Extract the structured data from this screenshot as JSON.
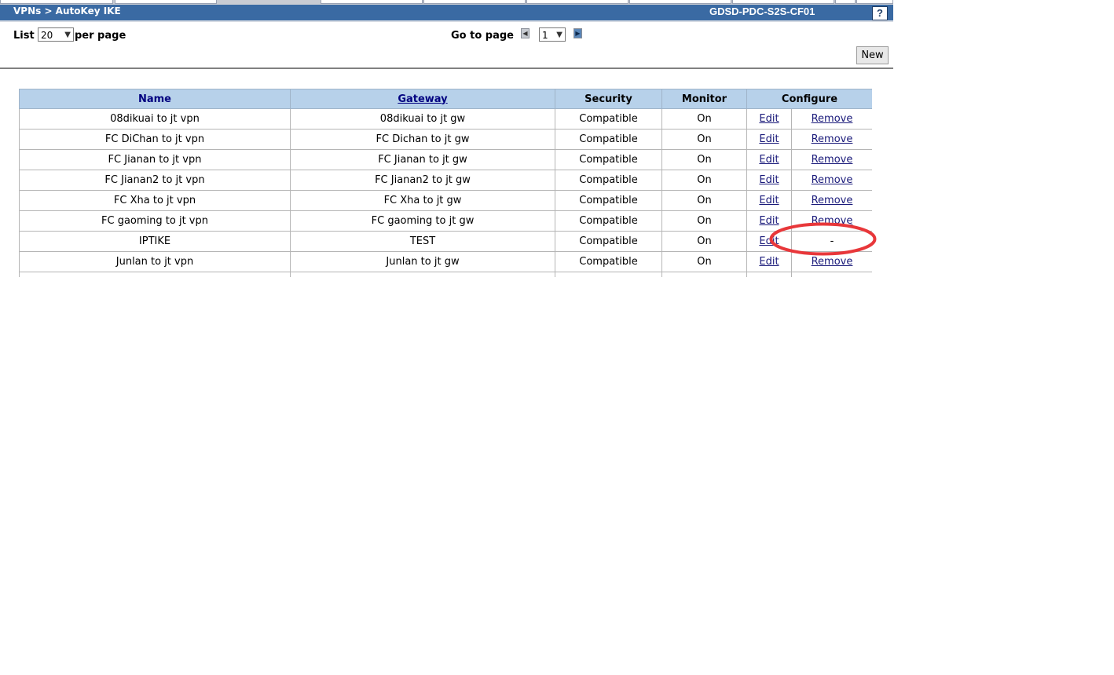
{
  "header": {
    "breadcrumb": "VPNs > AutoKey IKE",
    "device_name": "GDSD-PDC-S2S-CF01",
    "help_label": "?"
  },
  "controls": {
    "list_label": "List",
    "per_page_value": "20",
    "per_page_label": "per page",
    "goto_label": "Go to page",
    "page_value": "1",
    "new_label": "New"
  },
  "table": {
    "columns": {
      "name": "Name",
      "gateway": "Gateway",
      "security": "Security",
      "monitor": "Monitor",
      "configure": "Configure"
    },
    "rows": [
      {
        "name": "08dikuai to jt vpn",
        "gateway": "08dikuai to jt gw",
        "security": "Compatible",
        "monitor": "On",
        "edit": "Edit",
        "remove": "Remove"
      },
      {
        "name": "FC DiChan to jt vpn",
        "gateway": "FC Dichan to jt gw",
        "security": "Compatible",
        "monitor": "On",
        "edit": "Edit",
        "remove": "Remove"
      },
      {
        "name": "FC Jianan to jt vpn",
        "gateway": "FC Jianan to jt gw",
        "security": "Compatible",
        "monitor": "On",
        "edit": "Edit",
        "remove": "Remove"
      },
      {
        "name": "FC Jianan2 to jt vpn",
        "gateway": "FC Jianan2 to jt gw",
        "security": "Compatible",
        "monitor": "On",
        "edit": "Edit",
        "remove": "Remove"
      },
      {
        "name": "FC Xha to jt vpn",
        "gateway": "FC Xha to jt gw",
        "security": "Compatible",
        "monitor": "On",
        "edit": "Edit",
        "remove": "Remove"
      },
      {
        "name": "FC gaoming to jt vpn",
        "gateway": "FC gaoming to jt gw",
        "security": "Compatible",
        "monitor": "On",
        "edit": "Edit",
        "remove": "Remove"
      },
      {
        "name": "IPTIKE",
        "gateway": "TEST",
        "security": "Compatible",
        "monitor": "On",
        "edit": "Edit",
        "remove": "-"
      },
      {
        "name": "Junlan to jt vpn",
        "gateway": "Junlan to jt gw",
        "security": "Compatible",
        "monitor": "On",
        "edit": "Edit",
        "remove": "Remove"
      }
    ]
  },
  "colors": {
    "titlebar": "#3a6aa3",
    "table_header": "#b7d1ea",
    "annotation": "#e8373a"
  }
}
